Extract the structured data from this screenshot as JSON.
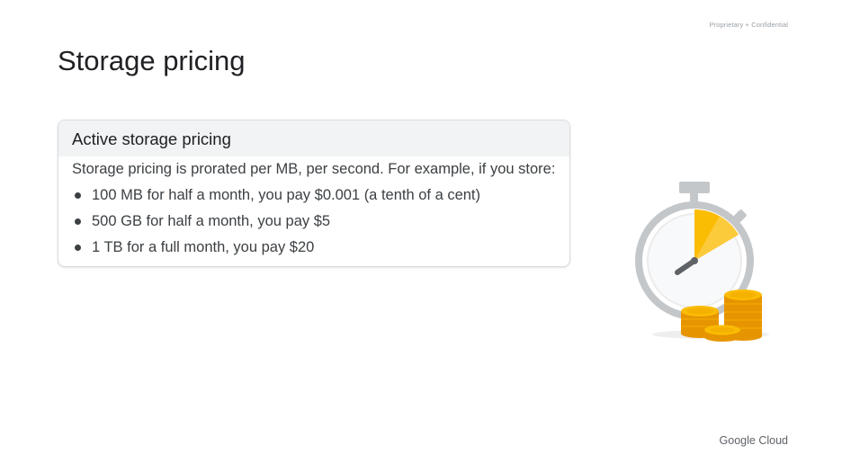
{
  "header": {
    "confidential": "Proprietary + Confidential",
    "title": "Storage pricing"
  },
  "card": {
    "title": "Active storage pricing",
    "intro": "Storage pricing is prorated per MB, per second. For example, if you store:",
    "bullets": [
      {
        "text": "100 MB for half a month, you pay $0.001 (a tenth of a cent)"
      },
      {
        "text": "500 GB for half a month, you pay $5"
      },
      {
        "text": "1 TB for a full month, you pay $20"
      }
    ]
  },
  "illustration": {
    "icon": "stopwatch-coins-icon",
    "colors": {
      "dial": "#c4c7ca",
      "accent": "#fbbc04",
      "coin": "#f4a100",
      "coin_dark": "#e69500",
      "hand": "#5f6368"
    }
  },
  "footer": {
    "logo": "Google Cloud"
  }
}
